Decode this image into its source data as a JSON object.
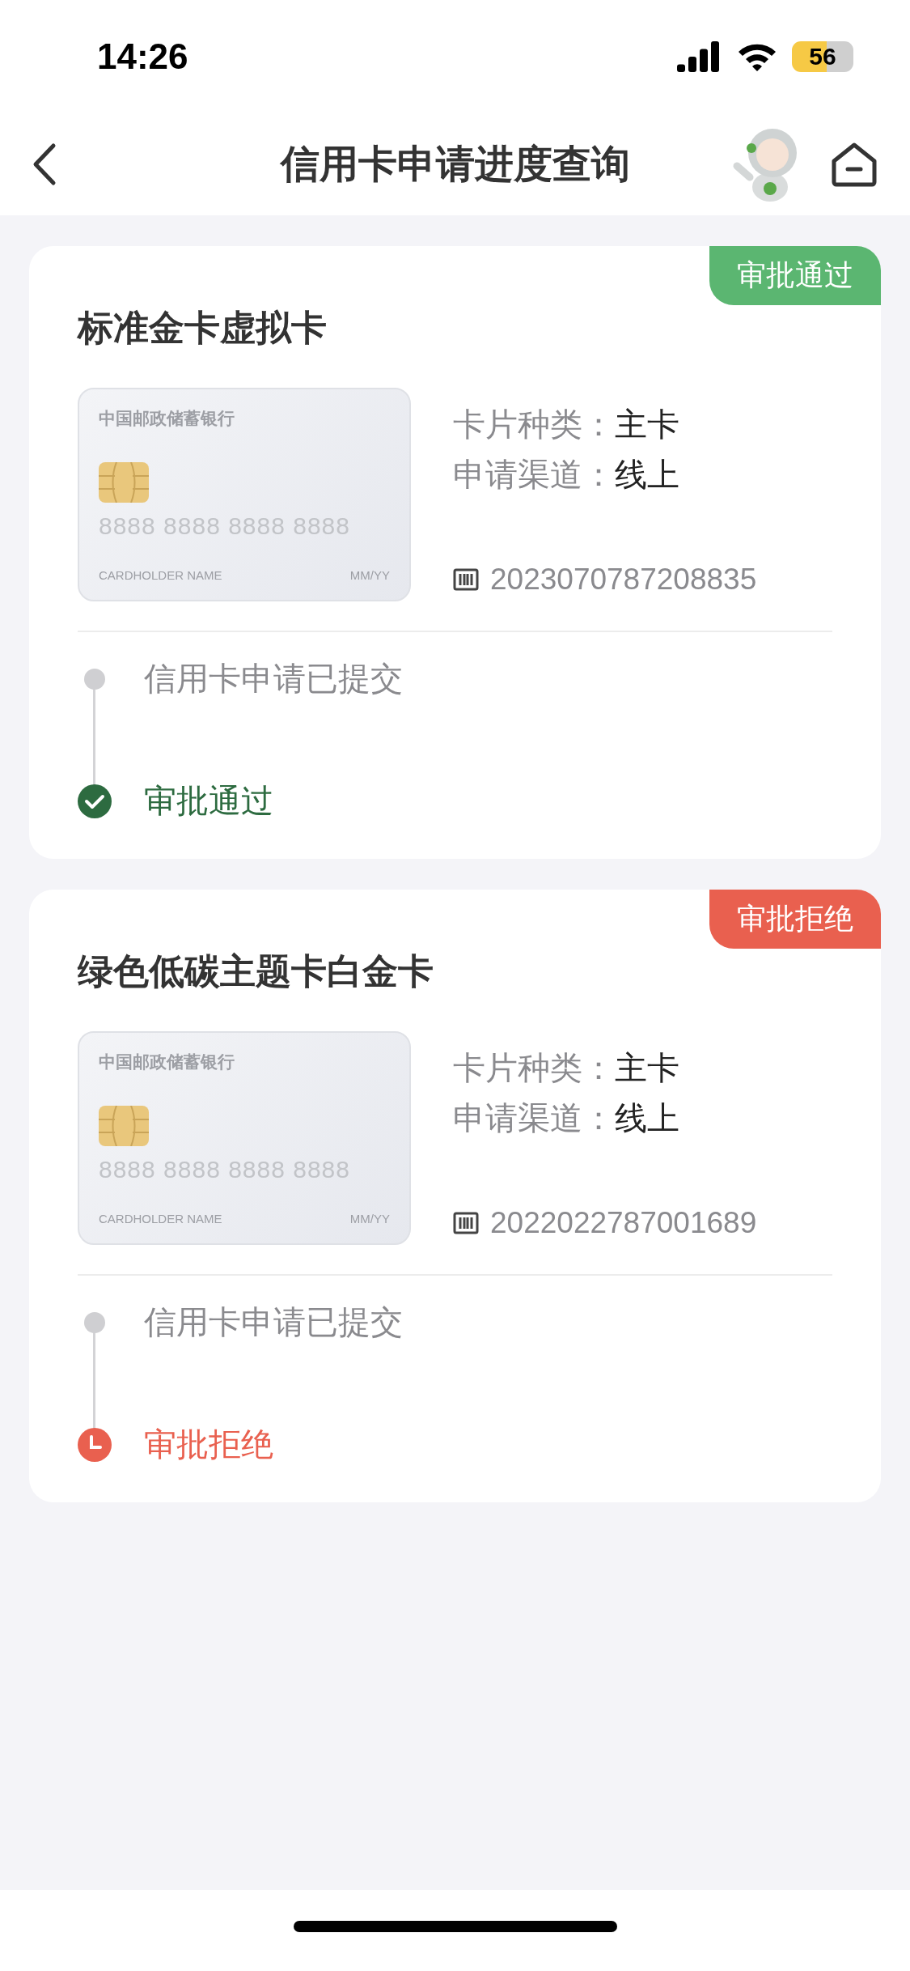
{
  "status_bar": {
    "time": "14:26",
    "battery": "56"
  },
  "header": {
    "title": "信用卡申请进度查询"
  },
  "applications": [
    {
      "kind": "approved",
      "badge": "审批通过",
      "name": "标准金卡虚拟卡",
      "card_art": {
        "bank": "中国邮政储蓄银行",
        "number": "8888 8888 8888 8888",
        "holder": "CARDHOLDER NAME",
        "expiry": "MM/YY"
      },
      "fields": [
        {
          "label": "卡片种类：",
          "value": "主卡"
        },
        {
          "label": "申请渠道：",
          "value": "线上"
        }
      ],
      "application_no": "2023070787208835",
      "steps": [
        {
          "kind": "submitted",
          "text": "信用卡申请已提交"
        },
        {
          "kind": "approved",
          "text": "审批通过"
        }
      ]
    },
    {
      "kind": "rejected",
      "badge": "审批拒绝",
      "name": "绿色低碳主题卡白金卡",
      "card_art": {
        "bank": "中国邮政储蓄银行",
        "number": "8888 8888 8888 8888",
        "holder": "CARDHOLDER NAME",
        "expiry": "MM/YY"
      },
      "fields": [
        {
          "label": "卡片种类：",
          "value": "主卡"
        },
        {
          "label": "申请渠道：",
          "value": "线上"
        }
      ],
      "application_no": "2022022787001689",
      "steps": [
        {
          "kind": "submitted",
          "text": "信用卡申请已提交"
        },
        {
          "kind": "rejected",
          "text": "审批拒绝"
        }
      ]
    }
  ]
}
